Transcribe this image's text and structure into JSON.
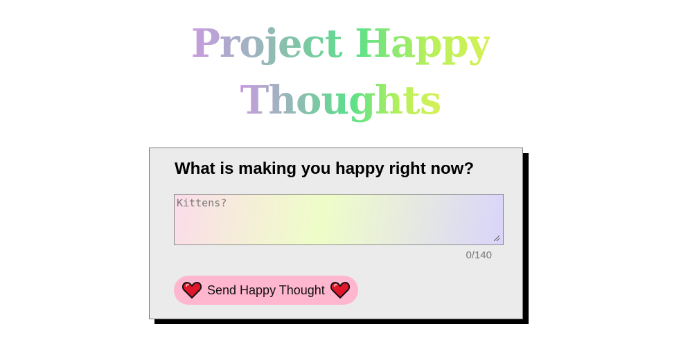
{
  "header": {
    "title_line1": "Project Happy",
    "title_line2": "Thoughts"
  },
  "form": {
    "question": "What is making you happy right now?",
    "placeholder": "Kittens?",
    "value": "",
    "char_count": "0/140",
    "send_label": "Send Happy Thought",
    "heart_icon": "heart-icon",
    "heart_color": "#e0162b"
  }
}
